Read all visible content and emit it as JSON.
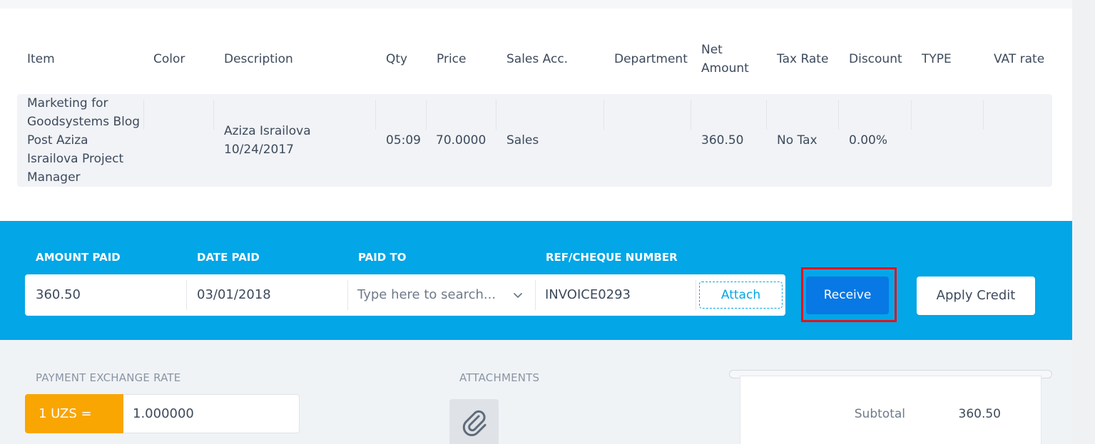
{
  "table": {
    "headers": {
      "item": "Item",
      "color": "Color",
      "description": "Description",
      "qty": "Qty",
      "price": "Price",
      "sales_acc": "Sales Acc.",
      "department": "Department",
      "net_amount_1": "Net",
      "net_amount_2": "Amount",
      "tax_rate": "Tax Rate",
      "discount": "Discount",
      "type": "TYPE",
      "vat_rate": "VAT rate"
    },
    "rows": [
      {
        "item_lines": [
          "Marketing for",
          "Goodsystems Blog",
          "Post Aziza",
          "Israilova Project",
          "Manager"
        ],
        "color": "",
        "description_lines": [
          "Aziza Israilova",
          "10/24/2017"
        ],
        "qty": "05:09",
        "price": "70.0000",
        "sales_acc": "Sales",
        "department": "",
        "net_amount": "360.50",
        "tax_rate": "No Tax",
        "discount": "0.00%",
        "type": "",
        "vat_rate": ""
      }
    ]
  },
  "payment": {
    "labels": {
      "amount_paid": "AMOUNT PAID",
      "date_paid": "DATE PAID",
      "paid_to": "PAID TO",
      "ref": "REF/CHEQUE NUMBER"
    },
    "amount_paid": "360.50",
    "date_paid": "03/01/2018",
    "paid_to_placeholder": "Type here to search...",
    "ref_number": "INVOICE0293",
    "attach_label": "Attach",
    "receive_label": "Receive",
    "apply_credit_label": "Apply Credit"
  },
  "exchange": {
    "label": "PAYMENT EXCHANGE RATE",
    "currency": "1 UZS =",
    "rate": "1.000000"
  },
  "attachments": {
    "label": "ATTACHMENTS",
    "icon": "paperclip-icon"
  },
  "totals": {
    "subtotal_label": "Subtotal",
    "subtotal_value": "360.50"
  },
  "colors": {
    "band": "#03a6e6",
    "receive": "#0878e4",
    "rate_tag": "#f9a602",
    "highlight": "#e0141e"
  }
}
